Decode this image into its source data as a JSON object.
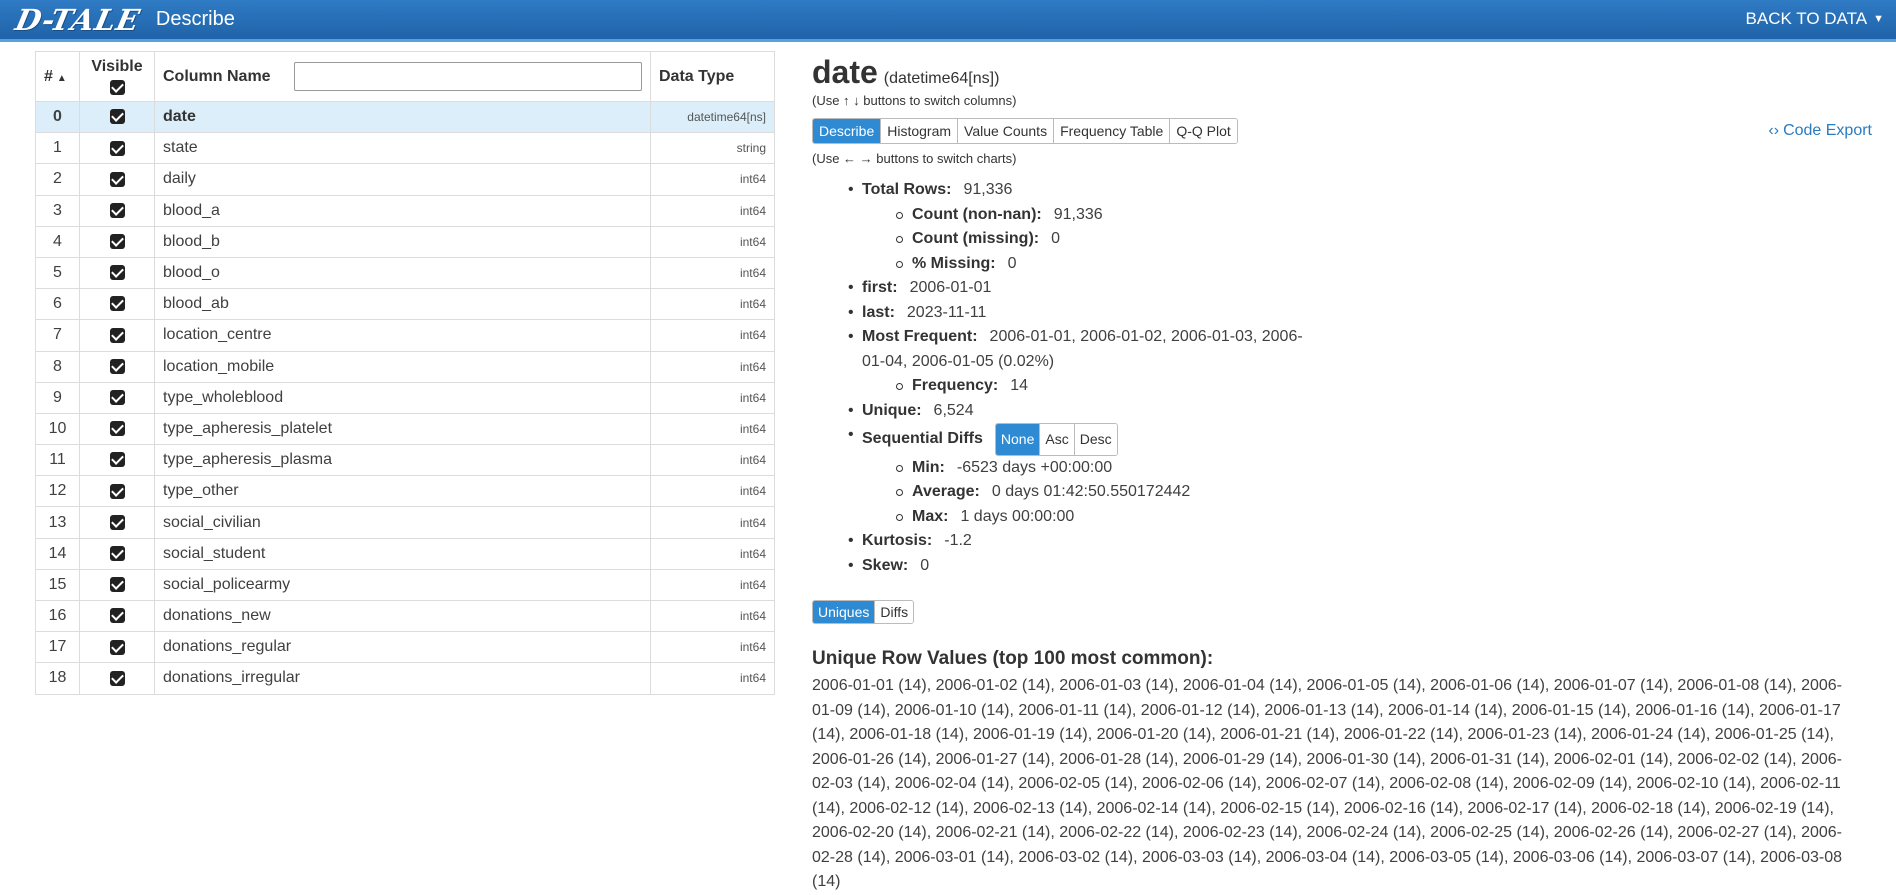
{
  "topbar": {
    "logo": "D-TALE",
    "title": "Describe",
    "back_label": "BACK TO DATA"
  },
  "table": {
    "headers": {
      "idx": "#",
      "visible": "Visible",
      "name": "Column Name",
      "type": "Data Type"
    },
    "filter_value": "",
    "rows": [
      {
        "idx": "0",
        "name": "date",
        "type": "datetime64[ns]",
        "visible": true
      },
      {
        "idx": "1",
        "name": "state",
        "type": "string",
        "visible": true
      },
      {
        "idx": "2",
        "name": "daily",
        "type": "int64",
        "visible": true
      },
      {
        "idx": "3",
        "name": "blood_a",
        "type": "int64",
        "visible": true
      },
      {
        "idx": "4",
        "name": "blood_b",
        "type": "int64",
        "visible": true
      },
      {
        "idx": "5",
        "name": "blood_o",
        "type": "int64",
        "visible": true
      },
      {
        "idx": "6",
        "name": "blood_ab",
        "type": "int64",
        "visible": true
      },
      {
        "idx": "7",
        "name": "location_centre",
        "type": "int64",
        "visible": true
      },
      {
        "idx": "8",
        "name": "location_mobile",
        "type": "int64",
        "visible": true
      },
      {
        "idx": "9",
        "name": "type_wholeblood",
        "type": "int64",
        "visible": true
      },
      {
        "idx": "10",
        "name": "type_apheresis_platelet",
        "type": "int64",
        "visible": true
      },
      {
        "idx": "11",
        "name": "type_apheresis_plasma",
        "type": "int64",
        "visible": true
      },
      {
        "idx": "12",
        "name": "type_other",
        "type": "int64",
        "visible": true
      },
      {
        "idx": "13",
        "name": "social_civilian",
        "type": "int64",
        "visible": true
      },
      {
        "idx": "14",
        "name": "social_student",
        "type": "int64",
        "visible": true
      },
      {
        "idx": "15",
        "name": "social_policearmy",
        "type": "int64",
        "visible": true
      },
      {
        "idx": "16",
        "name": "donations_new",
        "type": "int64",
        "visible": true
      },
      {
        "idx": "17",
        "name": "donations_regular",
        "type": "int64",
        "visible": true
      },
      {
        "idx": "18",
        "name": "donations_irregular",
        "type": "int64",
        "visible": true
      }
    ]
  },
  "detail": {
    "column_name": "date",
    "column_type": "(datetime64[ns])",
    "switch_columns_hint": "(Use ↑ ↓ buttons to switch columns)",
    "tabs": [
      "Describe",
      "Histogram",
      "Value Counts",
      "Frequency Table",
      "Q-Q Plot"
    ],
    "active_tab": "Describe",
    "code_export_label": "Code Export",
    "switch_charts_hint": "(Use ← → buttons to switch charts)",
    "stats": {
      "total_rows": {
        "label": "Total Rows:",
        "value": "91,336"
      },
      "count_non_nan": {
        "label": "Count (non-nan):",
        "value": "91,336"
      },
      "count_missing": {
        "label": "Count (missing):",
        "value": "0"
      },
      "pct_missing": {
        "label": "% Missing:",
        "value": "0"
      },
      "first": {
        "label": "first:",
        "value": "2006-01-01"
      },
      "last": {
        "label": "last:",
        "value": "2023-11-11"
      },
      "most_frequent": {
        "label": "Most Frequent:",
        "value": "2006-01-01, 2006-01-02, 2006-01-03, 2006-01-04, 2006-01-05 (0.02%)"
      },
      "frequency": {
        "label": "Frequency:",
        "value": "14"
      },
      "unique": {
        "label": "Unique:",
        "value": "6,524"
      },
      "sequential_diffs": {
        "label": "Sequential Diffs",
        "options": [
          "None",
          "Asc",
          "Desc"
        ],
        "active": "None"
      },
      "min": {
        "label": "Min:",
        "value": "-6523 days +00:00:00"
      },
      "average": {
        "label": "Average:",
        "value": "0 days 01:42:50.550172442"
      },
      "max": {
        "label": "Max:",
        "value": "1 days 00:00:00"
      },
      "kurtosis": {
        "label": "Kurtosis:",
        "value": "-1.2"
      },
      "skew": {
        "label": "Skew:",
        "value": "0"
      }
    },
    "ud_tabs": [
      "Uniques",
      "Diffs"
    ],
    "ud_active": "Uniques",
    "unique_title": "Unique Row Values (top 100 most common):",
    "unique_values": "2006-01-01 (14), 2006-01-02 (14), 2006-01-03 (14), 2006-01-04 (14), 2006-01-05 (14), 2006-01-06 (14), 2006-01-07 (14), 2006-01-08 (14), 2006-01-09 (14), 2006-01-10 (14), 2006-01-11 (14), 2006-01-12 (14), 2006-01-13 (14), 2006-01-14 (14), 2006-01-15 (14), 2006-01-16 (14), 2006-01-17 (14), 2006-01-18 (14), 2006-01-19 (14), 2006-01-20 (14), 2006-01-21 (14), 2006-01-22 (14), 2006-01-23 (14), 2006-01-24 (14), 2006-01-25 (14), 2006-01-26 (14), 2006-01-27 (14), 2006-01-28 (14), 2006-01-29 (14), 2006-01-30 (14), 2006-01-31 (14), 2006-02-01 (14), 2006-02-02 (14), 2006-02-03 (14), 2006-02-04 (14), 2006-02-05 (14), 2006-02-06 (14), 2006-02-07 (14), 2006-02-08 (14), 2006-02-09 (14), 2006-02-10 (14), 2006-02-11 (14), 2006-02-12 (14), 2006-02-13 (14), 2006-02-14 (14), 2006-02-15 (14), 2006-02-16 (14), 2006-02-17 (14), 2006-02-18 (14), 2006-02-19 (14), 2006-02-20 (14), 2006-02-21 (14), 2006-02-22 (14), 2006-02-23 (14), 2006-02-24 (14), 2006-02-25 (14), 2006-02-26 (14), 2006-02-27 (14), 2006-02-28 (14), 2006-03-01 (14), 2006-03-02 (14), 2006-03-03 (14), 2006-03-04 (14), 2006-03-05 (14), 2006-03-06 (14), 2006-03-07 (14), 2006-03-08 (14)"
  }
}
